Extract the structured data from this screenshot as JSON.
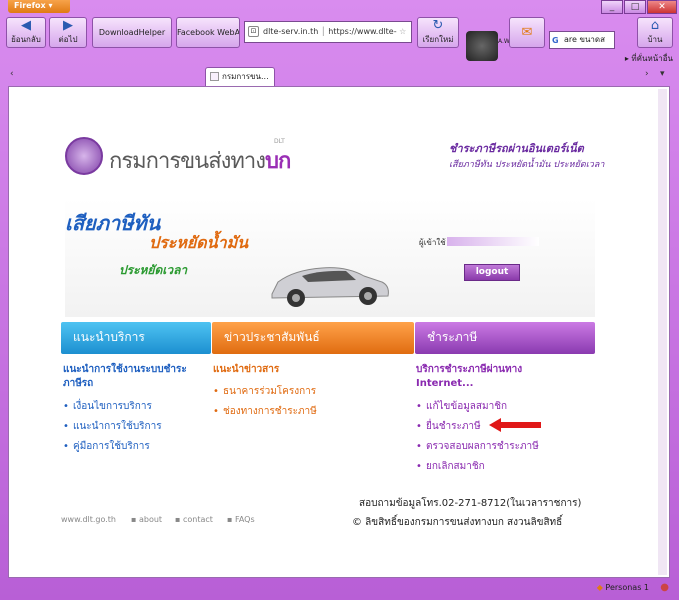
{
  "browser": {
    "app_button": "Firefox",
    "window_controls": [
      "_",
      "□",
      "✕"
    ],
    "nav": {
      "back": "ย้อนกลับ",
      "forward": "ต่อไป",
      "download_helper": "DownloadHelper",
      "webpage": "Facebook WebApp",
      "site_label": "dlte-serv.in.th",
      "url": "https://www.dlte-",
      "reload": "เรียกใหม่",
      "home": "บ้าน",
      "search_value": "are ขนาดส",
      "profile_name": "A.W.K"
    },
    "bookmarks_label": "ที่คั่นหน้าอื่น",
    "tab": {
      "title": "กรมการขน..."
    },
    "status": {
      "persona": "Personas",
      "count": "1"
    }
  },
  "page": {
    "logo": {
      "text_plain": "กรมการขนส่งทาง",
      "text_bold": "บก",
      "small": "DLT"
    },
    "tagline1": "ชำระภาษีรถผ่านอินเตอร์เน็ต",
    "tagline2": "เสียภาษีทัน ประหยัดน้ำมัน ประหยัดเวลา",
    "slogan1": "เสียภาษีทัน",
    "slogan2": "ประหยัดน้ำมัน",
    "slogan3": "ประหยัดเวลา",
    "user_label": "ผู้เข้าใช้",
    "logout_label": "logout",
    "menu": [
      "แนะนำบริการ",
      "ข่าวประชาสัมพันธ์",
      "ชำระภาษี"
    ],
    "col1": {
      "heading": "แนะนำการใช้งานระบบชำระภาษีรถ",
      "links": [
        "เงื่อนไขการบริการ",
        "แนะนำการใช้บริการ",
        "คู่มือการใช้บริการ"
      ]
    },
    "col2": {
      "heading": "แนะนำข่าวสาร",
      "links": [
        "ธนาคารร่วมโครงการ",
        "ช่องทางการชำระภาษี"
      ]
    },
    "col3": {
      "heading": "บริการชำระภาษีผ่านทาง Internet...",
      "links": [
        "แก้ไขข้อมูลสมาชิก",
        "ยื่นชำระภาษี",
        "ตรวจสอบผลการชำระภาษี",
        "ยกเลิกสมาชิก"
      ]
    },
    "contact": "สอบถามข้อมูลโทร.02-271-8712(ในเวลาราชการ)",
    "copyright": "© ลิขสิทธิ์ของกรมการขนส่งทางบก สงวนลิขสิทธิ์",
    "footer_links": [
      "www.dlt.go.th",
      "about",
      "contact",
      "FAQs"
    ]
  }
}
